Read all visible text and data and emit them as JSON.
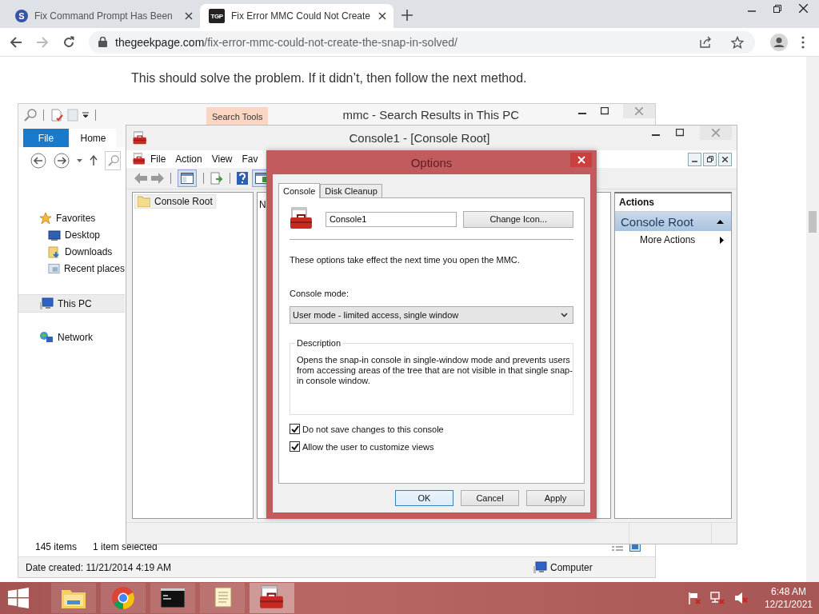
{
  "browser": {
    "tabs": [
      {
        "title": "Fix Command Prompt Has Been",
        "icon_text": "S",
        "kind": "round",
        "selected": false
      },
      {
        "title": "Fix Error MMC Could Not Create",
        "icon_text": "TGP",
        "kind": "square",
        "selected": true
      }
    ],
    "url": {
      "domain": "thegeekpage.com",
      "path": "/fix-error-mmc-could-not-create-the-snap-in-solved/"
    }
  },
  "article": {
    "text": "This should solve the problem. If it didn’t, then follow the next method."
  },
  "explorer": {
    "title": "mmc - Search Results in This PC",
    "context_tab": "Search Tools",
    "ribbon_tabs": [
      {
        "label": "File",
        "kind": "file"
      },
      {
        "label": "Home",
        "kind": "tab"
      }
    ],
    "nav": [
      {
        "label": "Favorites",
        "kind": "star",
        "selected": false,
        "children": [
          {
            "label": "Desktop",
            "kind": "desktop",
            "selected": false
          },
          {
            "label": "Downloads",
            "kind": "downloads",
            "selected": false
          },
          {
            "label": "Recent places",
            "kind": "recent",
            "selected": false
          }
        ]
      },
      {
        "label": "This PC",
        "kind": "pc",
        "selected": true
      },
      {
        "label": "Network",
        "kind": "network",
        "selected": false
      }
    ],
    "item_count": "145 items",
    "selection": "1 item selected",
    "details": "Date created: 11/21/2014 4:19 AM",
    "location": "Computer"
  },
  "mmc": {
    "title": "Console1 - [Console Root]",
    "menu": [
      "File",
      "Action",
      "View",
      "Fav"
    ],
    "tree": [
      {
        "label": "Console Root",
        "selected": true
      }
    ],
    "column_1": "N",
    "actions": {
      "header": "Actions",
      "group": "Console Root",
      "items": [
        "More Actions"
      ]
    }
  },
  "dialog": {
    "title": "Options",
    "tabs": [
      {
        "label": "Console",
        "selected": true
      },
      {
        "label": "Disk Cleanup",
        "selected": false
      }
    ],
    "name": "Console1",
    "change_icon": "Change Icon...",
    "note": "These options take effect the next time you open the MMC.",
    "mode_label": "Console mode:",
    "mode": "User mode - limited access, single window",
    "description_label": "Description",
    "description": "Opens the snap-in console in single-window mode and prevents users from accessing areas of the tree that are not visible in that single snap-in console window.",
    "checkboxes": [
      {
        "label": "Do not save changes to this console",
        "checked": true
      },
      {
        "label": "Allow the user to customize views",
        "checked": true
      }
    ],
    "buttons": [
      {
        "label": "OK",
        "kind": "default"
      },
      {
        "label": "Cancel",
        "kind": "normal"
      },
      {
        "label": "Apply",
        "kind": "normal"
      }
    ]
  },
  "taskbar": {
    "apps": [
      {
        "kind": "explorer",
        "selected": false
      },
      {
        "kind": "chrome",
        "selected": false
      },
      {
        "kind": "cmd",
        "selected": false
      },
      {
        "kind": "notepad",
        "selected": false
      },
      {
        "kind": "mmc",
        "selected": true
      }
    ],
    "time": "6:48 AM",
    "date": "12/21/2021"
  }
}
